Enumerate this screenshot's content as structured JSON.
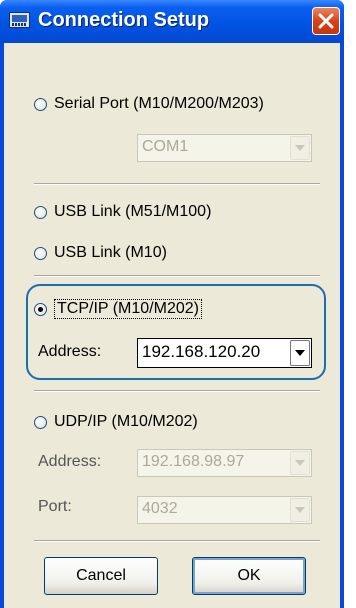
{
  "window": {
    "title": "Connection Setup",
    "icon": "connection-setup-icon",
    "close_icon": "close-icon"
  },
  "serial": {
    "label": "Serial Port (M10/M200/M203)",
    "selected": false,
    "port_value": "COM1"
  },
  "usb1": {
    "label": "USB Link (M51/M100)",
    "selected": false
  },
  "usb2": {
    "label": "USB Link (M10)",
    "selected": false
  },
  "tcp": {
    "label": "TCP/IP (M10/M202)",
    "selected": true,
    "address_label": "Address:",
    "address_value": "192.168.120.20"
  },
  "udp": {
    "label": "UDP/IP (M10/M202)",
    "selected": false,
    "address_label": "Address:",
    "address_value": "192.168.98.97",
    "port_label": "Port:",
    "port_value": "4032"
  },
  "buttons": {
    "cancel": "Cancel",
    "ok": "OK"
  },
  "colors": {
    "titlebar": "#0054e3",
    "dialog_face": "#ece9d8",
    "highlight_outline": "#1a6fb0",
    "close_button": "#d5441a"
  }
}
